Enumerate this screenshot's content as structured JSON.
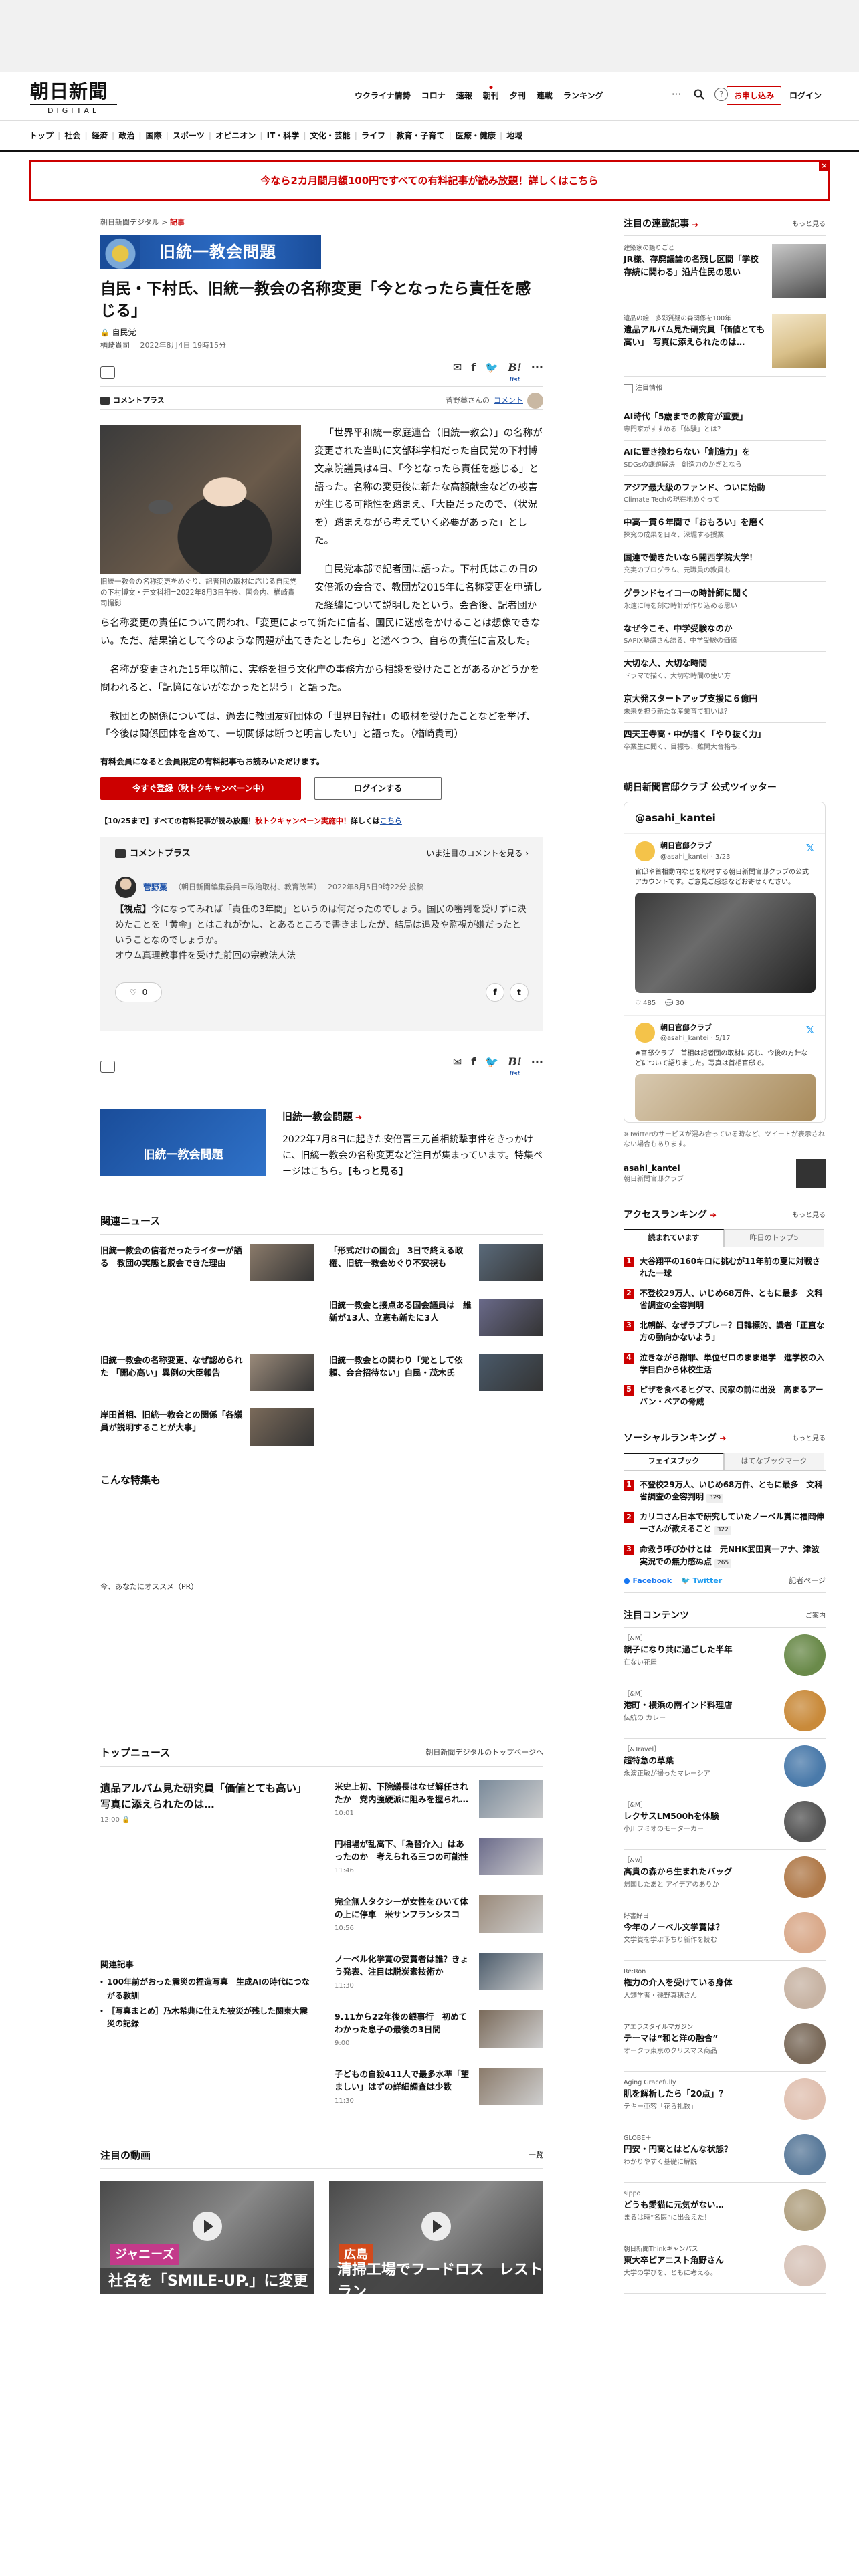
{
  "header": {
    "logo_jp": "朝日新聞",
    "logo_en": "DIGITAL",
    "topnav": [
      "ウクライナ情勢",
      "コロナ",
      "速報",
      "朝刊",
      "夕刊",
      "連載",
      "ランキング"
    ],
    "signup_label": "お申し込み",
    "login_label": "ログイン"
  },
  "catnav": [
    "トップ",
    "社会",
    "経済",
    "政治",
    "国際",
    "スポーツ",
    "オピニオン",
    "IT・科学",
    "文化・芸能",
    "ライフ",
    "教育・子育て",
    "医療・健康",
    "地域"
  ],
  "promo": {
    "text": "今なら2カ月間月額100円ですべての有料記事が読み放題！詳しくはこちら",
    "close": "×"
  },
  "article": {
    "breadcrumb_site": "朝日新聞デジタル",
    "breadcrumb_sep": ">",
    "breadcrumb_section": "記事",
    "tag_banner": "旧統一教会問題",
    "title": "自民・下村氏、旧統一教会の名称変更「今となったら責任を感じる」",
    "series": "自民党",
    "author": "楢崎貴司",
    "date": "2022年8月4日 19時15分",
    "share_list_label": "list",
    "share_count": "2",
    "commentplus_label": "コメントプラス",
    "commentplus_commenter": "菅野藁さんの",
    "commentplus_link": "コメント",
    "commentplus_count": "1",
    "photo_caption": "旧統一教会の名称変更をめぐり、記者団の取材に応じる自民党の下村博文・元文科相=2022年8月3日午後、国会内、楢崎貴司撮影",
    "paragraphs": [
      "「世界平和統一家庭連合（旧統一教会）」の名称が変更された当時に文部科学相だった自民党の下村博文衆院議員は4日、「今となったら責任を感じる」と語った。名称の変更後に新たな高額献金などの被害が生じる可能性を踏まえ、「大臣だったので、（状況を）踏まえながら考えていく必要があった」とした。",
      "自民党本部で記者団に語った。下村氏はこの日の安倍派の会合で、教団が2015年に名称変更を申請した経緯について説明したという。会合後、記者団から名称変更の責任について問われ、「変更によって新たに信者、国民に迷惑をかけることは想像できない。ただ、結果論として今のような問題が出てきたとしたら」と述べつつ、自らの責任に言及した。",
      "名称が変更された15年以前に、実務を担う文化庁の事務方から相談を受けたことがあるかどうかを問われると、「記憶にないがなかったと思う」と語った。",
      "教団との関係については、過去に教団友好団体の「世界日報社」の取材を受けたことなどを挙げ、「今後は関係団体を含めて、一切関係は断つと明言したい」と語った。（楢崎貴司）"
    ],
    "members_note": "有料会員になると会員限定の有料記事もお読みいただけます。",
    "register_label": "今すぐ登録（秋トクキャンペーン中）",
    "login_label": "ログインする",
    "campaign_note_a": "【10/25まで】すべての有料記事が読み放題！",
    "campaign_note_b": "秋トクキャンペーン実施中！",
    "campaign_note_c": "詳しくは",
    "campaign_note_link": "こちら"
  },
  "comment_plus": {
    "header": "コメントプラス",
    "right": "いま注目のコメントを見る",
    "name": "菅野藁",
    "affiliation": "（朝日新聞編集委員＝政治取材、教育改革）",
    "date": "2022年8月5日9時22分 投稿",
    "tag": "【視点】",
    "body": "今になってみれば「責任の3年間」というのは何だったのでしょう。国民の審判を受けずに決めたことを「黄金」とはこれがかに、とあるところで書きましたが、結局は追及や監視が嫌だったということなのでしょうか。",
    "body2": "オウム真理教事件を受けた前回の宗教法人法",
    "likes": "0",
    "fb": "f",
    "tw": "t"
  },
  "special": {
    "banner": "旧統一教会問題",
    "title": "旧統一教会問題",
    "desc": "2022年7月8日に起きた安倍晋三元首相銃撃事件をきっかけに、旧統一教会の名称変更など注目が集まっています。特集ページはこちら。",
    "more": "[もっと見る]"
  },
  "related": {
    "heading": "関連ニュース",
    "items": [
      {
        "title": "旧統一教会の信者だったライターが語る　教団の実態と脱会できた理由"
      },
      {
        "title": "「形式だけの国会」 3日で終える政権、旧統一教会めぐり不安視も"
      },
      {
        "title": ""
      },
      {
        "title": "旧統一教会と接点ある国会議員は　維新が13人、立憲も新たに3人"
      },
      {
        "title": "旧統一教会の名称変更、なぜ認められた 「開心高い」異例の大臣報告"
      },
      {
        "title": "旧統一教会との関わり「党として依頼、会合招待ない」自民・茂木氏"
      },
      {
        "title": "岸田首相、旧統一教会との関係「各議員が説明することが大事」"
      }
    ]
  },
  "special2_heading": "こんな特集も",
  "for_you_label": "今、あなたにオススメ（PR）",
  "topnews": {
    "heading": "トップニュース",
    "link": "朝日新聞デジタルのトップページへ",
    "lead_title": "遺品アルバム見た研究員「価値とても高い」　写真に添えられたのは…",
    "lead_time": "12:00",
    "items": [
      {
        "title": "米史上初、下院議長はなぜ解任されたか　党内強硬派に阻みを握られ…",
        "time": "10:01"
      },
      {
        "title": "円相場が乱高下、「為替介入」はあったのか　考えられる三つの可能性",
        "time": "11:46"
      },
      {
        "title": "完全無人タクシーが女性をひいて体の上に停車　米サンフランシスコ",
        "time": "10:56"
      },
      {
        "title": "ノーベル化学賞の受賞者は誰？きょう発表、注目は脱炭素技術か",
        "time": "11:30"
      },
      {
        "title": "9.11から22年後の銀事行　初めてわかった息子の最後の3日間",
        "time": "9:00"
      },
      {
        "title": "子どもの自殺411人で最多水準「望ましい」はずの詳細調査は少数",
        "time": "11:30"
      }
    ],
    "rel_heading": "関連記事",
    "rel_items": [
      "100年前がおった震災の捏造写真　生成AIの時代につながる教訓",
      "［写真まとめ］乃木希典に仕えた被災が残した関東大震災の記録"
    ]
  },
  "videos": {
    "heading": "注目の動画",
    "link": "一覧",
    "items": [
      {
        "badge": "ジャニーズ",
        "caption": "社名を「SMILE-UP.」に変更"
      },
      {
        "badge": "広島",
        "caption": "清掃工場でフードロス　レストラン"
      }
    ]
  },
  "sidebar": {
    "featured_heading": "注目の連載記事",
    "more": "もっと見る",
    "featured": [
      {
        "kicker": "建築家の語りごと",
        "title": "JR様、存廃議論の名残し区間「学校存続に関わる」沿片住民の思い"
      },
      {
        "kicker": "遺品の絵　多彩質疑の森関係を100年",
        "title": "遺品アルバム見た研究員「価値とても高い」　写真に添えられたのは…"
      }
    ],
    "ad_note": "注目情報",
    "attention": [
      {
        "title": "AI時代「5歳までの教育が重要」",
        "sub": "専門家がすすめる「体験」とは？"
      },
      {
        "title": "AIに置き換わらない「創造力」を",
        "sub": "SDGsの課題解決　創造力のかぎとなら"
      },
      {
        "title": "アジア最大級のファンド、ついに始動",
        "sub": "Climate Techの現在地めぐって"
      },
      {
        "title": "中高一貫６年間で「おもろい」を磨く",
        "sub": "探究の成果を日々、深堀する授業"
      },
      {
        "title": "国連で働きたいなら開西学院大学！",
        "sub": "充実のプログラム、元職員の教員も"
      },
      {
        "title": "グランドセイコーの時計師に聞く",
        "sub": "永遠に時を刻む時計が作り込める思い"
      },
      {
        "title": "なぜ今こそ、中学受験なのか",
        "sub": "SAPIX塾講さん語る、中学受験の価値"
      },
      {
        "title": "大切な人、大切な時間",
        "sub": "ドラマで描く、大切な時間の使い方"
      },
      {
        "title": "京大発スタートアップ支援に６億円",
        "sub": "未来を担う新たな産業育て狙いは？"
      },
      {
        "title": "四天王寺高・中が描く「やり抜く力」",
        "sub": "卒業生に聞く、目標も、難関大合格も！"
      }
    ],
    "twitter_heading": "朝日新聞官邸クラブ 公式ツイッター",
    "twitter_account": "@asahi_kantei",
    "tweets": [
      {
        "name": "朝日官邸クラブ",
        "handle": "@asahi_kantei · 3/23",
        "text": "官邸や首相動向などを取材する朝日新聞官邸クラブの公式アカウントです。ご意見ご感想などお寄せください。",
        "acts": "485",
        "acts2": "30"
      },
      {
        "name": "朝日官邸クラブ",
        "handle": "@asahi_kantei · 5/17",
        "text": "#官邸クラブ　首相は記者団の取材に応じ、今後の方針などについて語りました。写真は首相官邸で。"
      }
    ],
    "tw_footnote": "※Twitterのサービスが混み合っている時など、ツイートが表示されない場合もあります。",
    "tw_acct_name": "asahi_kantei",
    "tw_acct_sub": "朝日新聞官邸クラブ",
    "ranking_heading": "アクセスランキング",
    "ranking_tabs": [
      "読まれています",
      "昨日のトップ5"
    ],
    "ranking": [
      "大谷翔平の160キロに挑むが11年前の夏に対戦された一球",
      "不登校29万人、いじめ68万件、ともに最多　文科省調査の全容判明",
      "北朝鮮、なぜラブブレー？日韓標的、識者「正直な方の動向かないよう」",
      "泣きながら謝罪、単位ゼロのまま退学　進学校の入学目白から休校生活",
      "ピザを食べるヒグマ、民家の前に出没　高まるアーバン・ベアの脅威"
    ],
    "social_heading": "ソーシャルランキング",
    "social_tabs": [
      "フェイスブック",
      "はてなブックマーク"
    ],
    "social": [
      {
        "title": "不登校29万人、いじめ68万件、ともに最多　文科省調査の全容判明",
        "count": "329"
      },
      {
        "title": "カリコさん日本で研究していたノーベル賞に福岡伸一さんが教えること",
        "count": "322"
      },
      {
        "title": "命救う呼びかけとは　元NHK武田真一アナ、津波実況での無力感ぬ点",
        "count": "265"
      }
    ],
    "sns_fb": "Facebook",
    "sns_tw": "Twitter",
    "sns_right": "記者ページ",
    "contents_heading": "注目コンテンツ",
    "contents_link": "ご案内",
    "contents": [
      {
        "kicker": "［&M］",
        "title": "親子になり共に過ごした半年",
        "sub": "在ない花屋"
      },
      {
        "kicker": "［&M］",
        "title": "港町・横浜の南インド料理店",
        "sub": "伝統の カレー"
      },
      {
        "kicker": "［&Travel］",
        "title": "超特急の草葉",
        "sub": "永演正敏が撮ったマレーシア"
      },
      {
        "kicker": "［&M］",
        "title": "レクサスLM500hを体験",
        "sub": "小川フミオのモーターカー"
      },
      {
        "kicker": "［&w］",
        "title": "高貴の森から生まれたバッグ",
        "sub": "帰国したあと アイデアのありか"
      },
      {
        "kicker": "好書好日",
        "title": "今年のノーベル文学賞は？",
        "sub": "文学賞を学ぶ予ちり新作を読む"
      },
      {
        "kicker": "Re:Ron",
        "title": "権力の介入を受けている身体",
        "sub": "人類学者・磯野真穂さん"
      },
      {
        "kicker": "アエラスタイルマガジン",
        "title": "テーマは“和と洋の融合”",
        "sub": "オークラ東京のクリスマス商品"
      },
      {
        "kicker": "Aging Gracefully",
        "title": "肌を解析したら「20点」？",
        "sub": "テキー亜容「花ら扎数」"
      },
      {
        "kicker": "GLOBE＋",
        "title": "円安・円高とはどんな状態？",
        "sub": "わかりやすく基礎に解説"
      },
      {
        "kicker": "sippo",
        "title": "どうも愛猫に元気がない…",
        "sub": "まるは時“名医”に出会えた！"
      },
      {
        "kicker": "朝日新聞Thinkキャンパス",
        "title": "東大卒ピアニスト角野さん",
        "sub": "大学の学びを、ともに考える。"
      }
    ]
  },
  "icons": {
    "search": "search-icon",
    "help": "help-icon",
    "more": "more-icon",
    "mail": "mail-icon",
    "print": "print-icon"
  },
  "colors": {
    "brand_red": "#cc0000",
    "banner_blue": "#1a4d9a",
    "link_blue": "#2255aa"
  }
}
